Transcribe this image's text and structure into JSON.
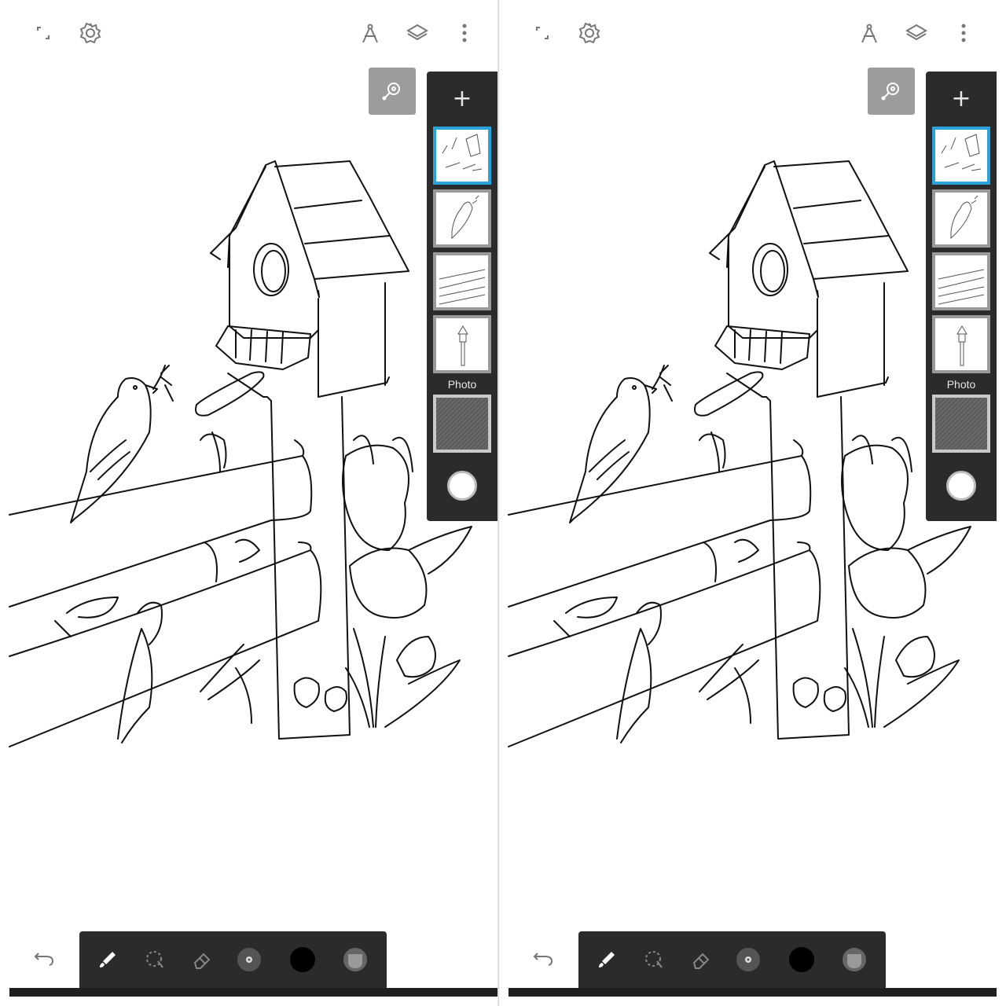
{
  "screens": [
    {
      "id": "left",
      "topbar": {
        "icons": [
          "fullscreen-icon",
          "settings-icon",
          "perspective-guide-icon",
          "layers-icon",
          "more-vert-icon"
        ]
      },
      "search_icon": "magnifier-icon",
      "layers": {
        "add_label": "+",
        "thumbnails": [
          "layer-scene",
          "layer-bird",
          "layer-fence",
          "layer-birdhouse"
        ],
        "active_index": 0,
        "photo_label": "Photo",
        "opacity_icon": "circle-icon"
      },
      "toolbar": {
        "tools": [
          "brush-icon",
          "lasso-select-icon",
          "eraser-icon",
          "brush-size-icon",
          "color-swatch-icon",
          "brush-opacity-icon"
        ],
        "color": "#000000"
      },
      "undo_icon": "undo-icon"
    },
    {
      "id": "right",
      "topbar": {
        "icons": [
          "fullscreen-icon",
          "settings-icon",
          "perspective-guide-icon",
          "layers-icon",
          "more-vert-icon"
        ]
      },
      "search_icon": "magnifier-icon",
      "layers": {
        "add_label": "+",
        "thumbnails": [
          "layer-scene",
          "layer-bird",
          "layer-fence",
          "layer-birdhouse"
        ],
        "active_index": 0,
        "photo_label": "Photo",
        "opacity_icon": "circle-icon"
      },
      "toolbar": {
        "tools": [
          "brush-icon",
          "lasso-select-icon",
          "eraser-icon",
          "brush-size-icon",
          "color-swatch-icon",
          "brush-opacity-icon"
        ],
        "color": "#000000"
      },
      "undo_icon": "undo-icon"
    }
  ],
  "colors": {
    "panel": "#2b2b2b",
    "active_layer": "#2aa3dc",
    "search_button": "#9c9c9c",
    "line_art": "#111111"
  }
}
